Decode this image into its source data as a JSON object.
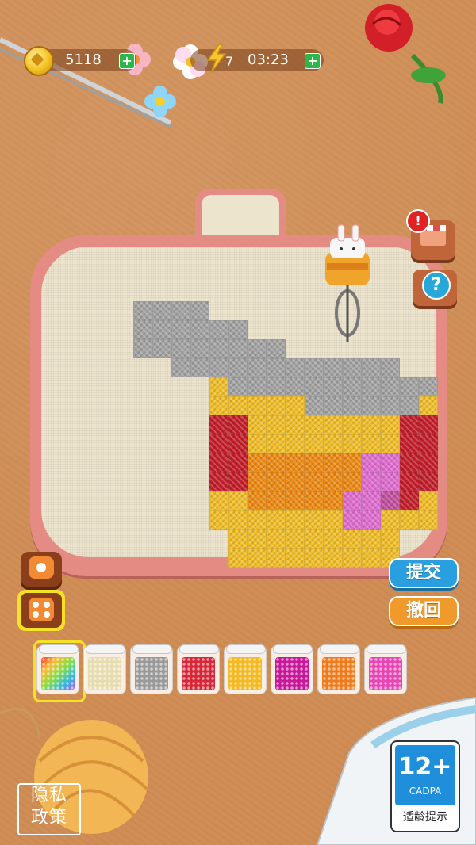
{
  "hud": {
    "coins": "5118",
    "energy": "7",
    "timer": "03:23",
    "coins_add_label": "+",
    "timer_add_label": "+"
  },
  "actions": {
    "submit_label": "提交",
    "undo_label": "撤回"
  },
  "side_buttons": {
    "shop_icon": "shop-icon",
    "help_label": "?",
    "shop_alert": "!"
  },
  "palette": [
    {
      "name": "rainbow",
      "color": "#8fd14f",
      "selected": true
    },
    {
      "name": "cream",
      "color": "#e7dcb0",
      "selected": false
    },
    {
      "name": "gray",
      "color": "#9a9a9a",
      "selected": false
    },
    {
      "name": "red",
      "color": "#d7283a",
      "selected": false
    },
    {
      "name": "yellow",
      "color": "#f5b921",
      "selected": false
    },
    {
      "name": "magenta",
      "color": "#c7189a",
      "selected": false
    },
    {
      "name": "orange",
      "color": "#f07b1b",
      "selected": false
    },
    {
      "name": "pink",
      "color": "#e845b3",
      "selected": false
    }
  ],
  "pattern_colors": {
    "G": "#a3a3a3",
    "Y": "#f2be26",
    "R": "#c51c2a",
    "O": "#ee8a12",
    "P": "#e06cd0",
    "M": "#c24f9e"
  },
  "pattern_rows": [
    "GGGG............",
    "GGGGGG..........",
    "GGGGGGGG........",
    "..GGGGGGGGGGGG..",
    "....YGGGGGGGGGGG",
    "....YYYYYGGGGGGY",
    "....RRYYYYYYYYRR",
    "....RRYYYYYYYYRR",
    "....RROOOOOOPPRR",
    "....RROOOOOOPPRR",
    "....YYOOOOOPPMRY",
    "....YYYYYYYPPYYY",
    ".....YYYYYYYYY..",
    ".....YYYYYYYYY.."
  ],
  "age_rating": {
    "rating": "12+",
    "org": "CADPA",
    "caption": "适龄提示"
  },
  "privacy": {
    "line1": "隐私",
    "line2": "政策"
  }
}
